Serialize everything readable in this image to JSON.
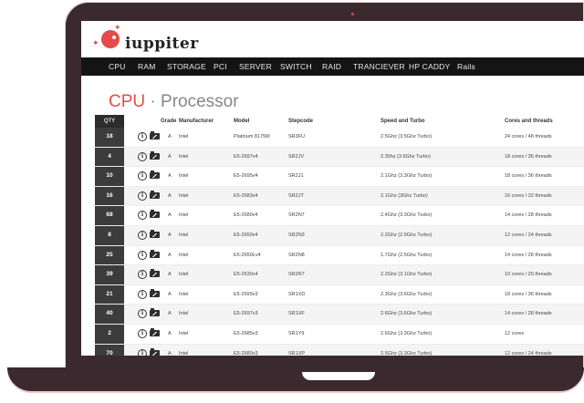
{
  "brand": {
    "name": "iuppiter"
  },
  "nav": [
    "CPU",
    "RAM",
    "STORAGE",
    "PCI",
    "SERVER",
    "SWITCH",
    "RAID",
    "TRANCIEVER",
    "HP CADDY",
    "Rails"
  ],
  "page": {
    "title_accent": "CPU",
    "title_sep": " · ",
    "title_rest": "Processor"
  },
  "table": {
    "headers": {
      "qty": "QTY",
      "grade": "Grade",
      "manufacturer": "Manufacturer",
      "model": "Model",
      "stepcode": "Stepcode",
      "speed": "Speed and Turbo",
      "cores": "Cores and threads"
    },
    "rows": [
      {
        "qty": "18",
        "grade": "A",
        "manufacturer": "Intel",
        "model": "Platinum 8175M",
        "stepcode": "SR3FU",
        "speed": "2.5Ghz (3.5Ghz Turbo)",
        "cores": "24 cores / 48 threads"
      },
      {
        "qty": "4",
        "grade": "A",
        "manufacturer": "Intel",
        "model": "E5-2697v4",
        "stepcode": "SR2JV",
        "speed": "2.30hz (3.6Ghz Turbo)",
        "cores": "18 cores / 36 threads"
      },
      {
        "qty": "10",
        "grade": "A",
        "manufacturer": "Intel",
        "model": "E5-2695v4",
        "stepcode": "SR2J1",
        "speed": "2.1Ghz (3.3Ghz Turbo)",
        "cores": "18 cores / 36 threads"
      },
      {
        "qty": "16",
        "grade": "A",
        "manufacturer": "Intel",
        "model": "E5-2683v4",
        "stepcode": "SR2JT",
        "speed": "2.1Ghz (3Ghz Turbo)",
        "cores": "16 cores / 32 threads"
      },
      {
        "qty": "68",
        "grade": "A",
        "manufacturer": "Intel",
        "model": "E5-2680v4",
        "stepcode": "SR2N7",
        "speed": "2.4Ghz (3.3Ghz Turbo)",
        "cores": "14 cores / 28 threads"
      },
      {
        "qty": "8",
        "grade": "A",
        "manufacturer": "Intel",
        "model": "E5-2650v4",
        "stepcode": "SR2N3",
        "speed": "2.2Ghz (2.9Ghz Turbo)",
        "cores": "12 cores / 24 threads"
      },
      {
        "qty": "25",
        "grade": "A",
        "manufacturer": "Intel",
        "model": "E5-2650Lv4",
        "stepcode": "SR2N8",
        "speed": "1.7Ghz (2.5Ghz Turbo)",
        "cores": "14 cores / 28 threads"
      },
      {
        "qty": "39",
        "grade": "A",
        "manufacturer": "Intel",
        "model": "E5-2630v4",
        "stepcode": "SR2R7",
        "speed": "2.2Ghz (3.1Ghz Turbo)",
        "cores": "10 cores / 20 threads"
      },
      {
        "qty": "21",
        "grade": "A",
        "manufacturer": "Intel",
        "model": "E5-2699v3",
        "stepcode": "SR1XD",
        "speed": "2.3Ghz (3.6Ghz Turbo)",
        "cores": "18 cores / 36 threads"
      },
      {
        "qty": "40",
        "grade": "A",
        "manufacturer": "Intel",
        "model": "E5-2697v3",
        "stepcode": "SR1XF",
        "speed": "2.6Ghz (3.6Ghz Turbo)",
        "cores": "14 cores / 28 threads"
      },
      {
        "qty": "2",
        "grade": "A",
        "manufacturer": "Intel",
        "model": "E5-2685v3",
        "stepcode": "SR1Y9",
        "speed": "2.6Ghz (3.3Ghz Turbo)",
        "cores": "12 cores"
      },
      {
        "qty": "70",
        "grade": "A",
        "manufacturer": "Intel",
        "model": "E5-2680v3",
        "stepcode": "SR1XP",
        "speed": "2.5Ghz (3.3Ghz Turbo)",
        "cores": "12 cores / 24 threads"
      }
    ]
  },
  "colors": {
    "accent": "#e54b48",
    "nav_bg": "#141414",
    "laptop_body": "#3a2a30"
  }
}
